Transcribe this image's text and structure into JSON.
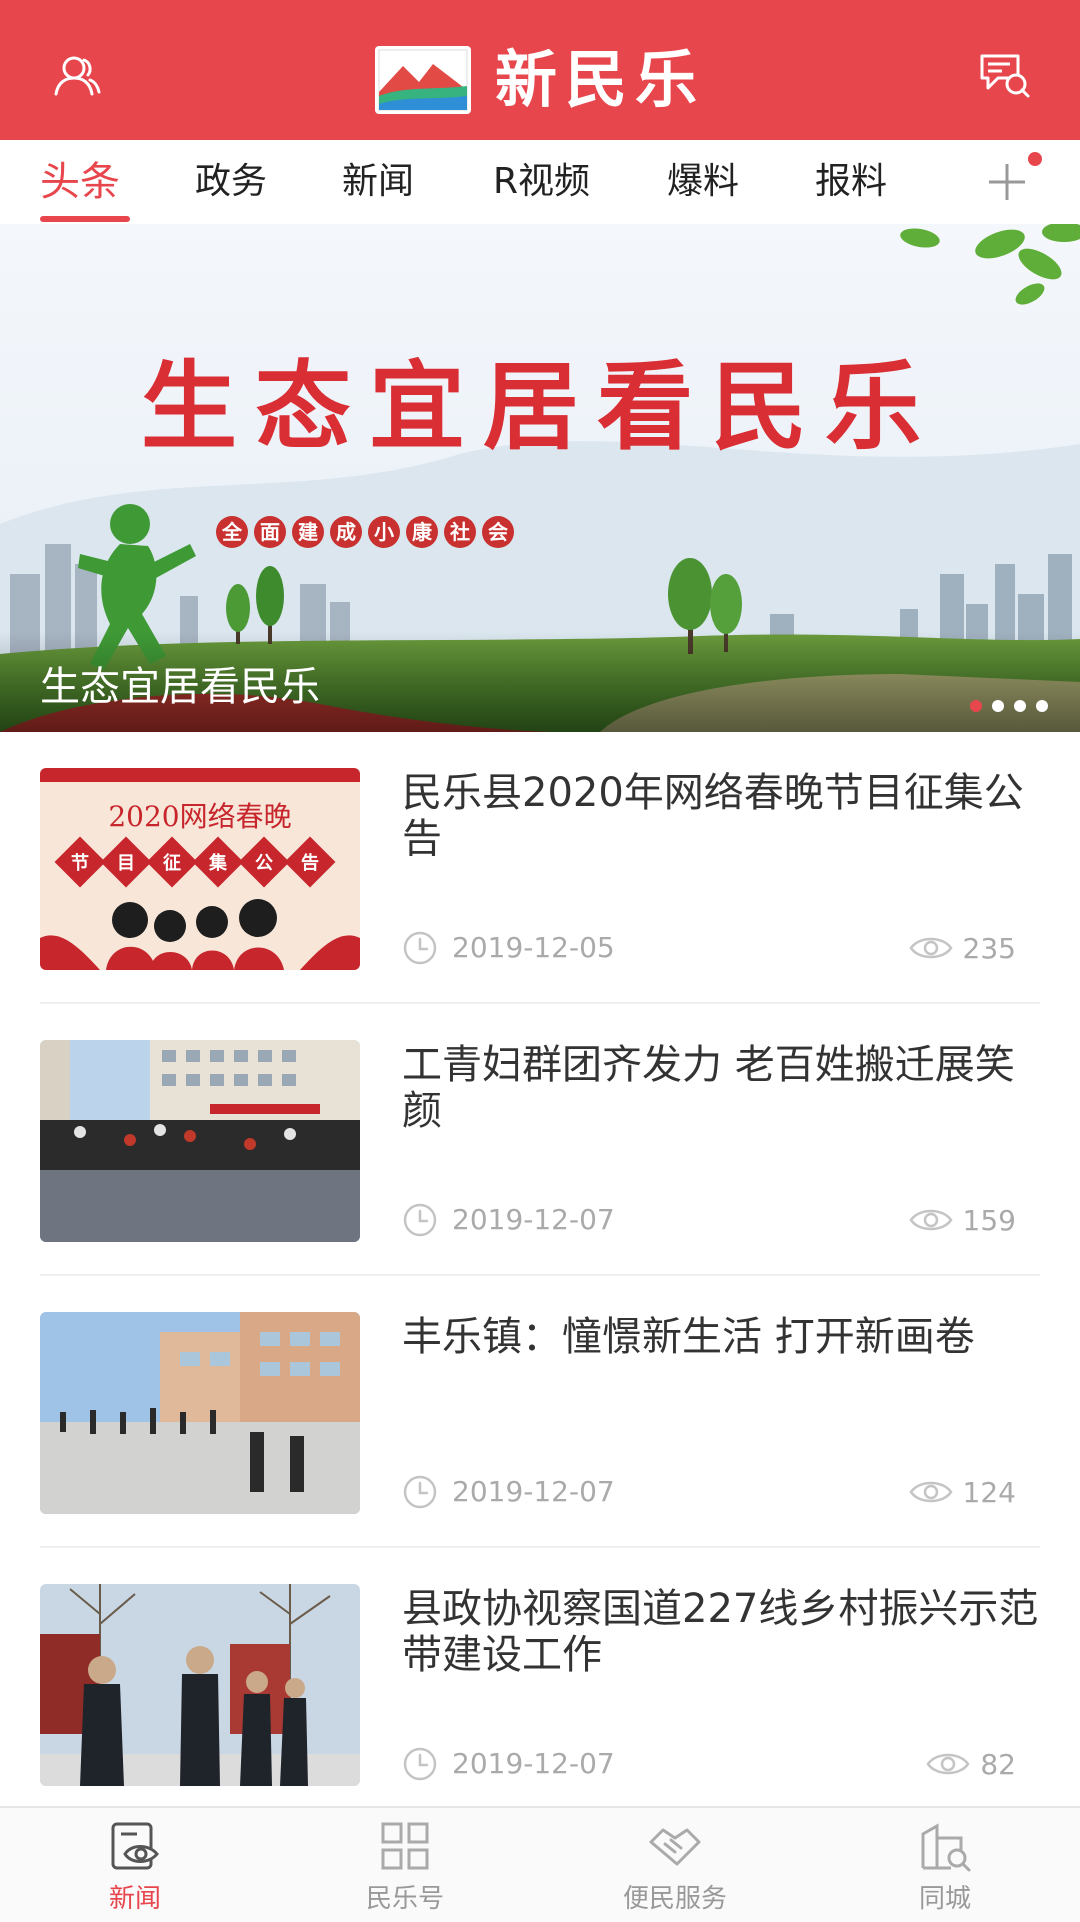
{
  "header": {
    "brand": "新民乐",
    "left_icon": "user-icon",
    "right_icon": "message-icon",
    "color": "#e8464d"
  },
  "tabs": [
    {
      "label": "头条",
      "active": true
    },
    {
      "label": "政务",
      "active": false
    },
    {
      "label": "新闻",
      "active": false
    },
    {
      "label": "R视频",
      "active": false
    },
    {
      "label": "爆料",
      "active": false
    },
    {
      "label": "报料",
      "active": false
    }
  ],
  "add_tab_icon": "plus-icon",
  "banner": {
    "main_text": "生态宜居看民乐",
    "sub_text": [
      "全",
      "面",
      "建",
      "成",
      "小",
      "康",
      "社",
      "会"
    ],
    "caption": "生态宜居看民乐",
    "slides": 4,
    "active_slide": 1
  },
  "news": [
    {
      "title": "民乐县2020年网络春晚节目征集公告",
      "date": "2019-12-05",
      "views": "235",
      "thumb_title": "2020网络春晚",
      "thumb_sub": [
        "节",
        "目",
        "征",
        "集",
        "公",
        "告"
      ]
    },
    {
      "title": "工青妇群团齐发力 老百姓搬迁展笑颜",
      "date": "2019-12-07",
      "views": "159"
    },
    {
      "title": "丰乐镇：憧憬新生活 打开新画卷",
      "date": "2019-12-07",
      "views": "124"
    },
    {
      "title": "县政协视察国道227线乡村振兴示范带建设工作",
      "date": "2019-12-07",
      "views": "82"
    }
  ],
  "bottom_nav": [
    {
      "label": "新闻",
      "icon": "news-eye-icon",
      "active": true
    },
    {
      "label": "民乐号",
      "icon": "grid-icon",
      "active": false
    },
    {
      "label": "便民服务",
      "icon": "handshake-icon",
      "active": false
    },
    {
      "label": "同城",
      "icon": "city-search-icon",
      "active": false
    }
  ],
  "colors": {
    "accent": "#e8464d",
    "muted": "#aaaaaa",
    "text": "#333333"
  }
}
